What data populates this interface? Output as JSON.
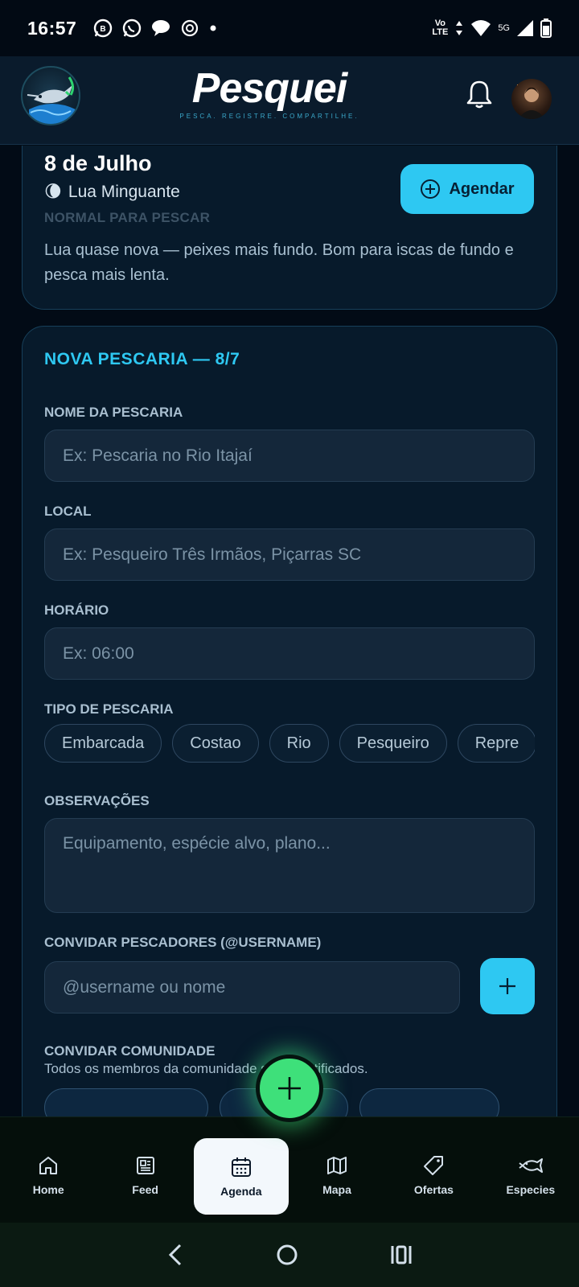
{
  "status_bar": {
    "time": "16:57",
    "network_top": "Vo",
    "network_bottom": "LTE",
    "signal_label": "5G"
  },
  "header": {
    "brand_name": "Pesquei",
    "brand_tagline": "PESCA. REGISTRE. COMPARTILHE."
  },
  "moon_card": {
    "date": "8 de Julho",
    "moon_icon": "🌘",
    "moon_phase": "Lua Minguante",
    "status": "NORMAL PARA PESCAR",
    "description": "Lua quase nova — peixes mais fundo. Bom para iscas de fundo e pesca mais lenta.",
    "schedule_button": "Agendar"
  },
  "form": {
    "title": "NOVA PESCARIA — 8/7",
    "name_label": "NOME DA PESCARIA",
    "name_placeholder": "Ex: Pescaria no Rio Itajaí",
    "location_label": "LOCAL",
    "location_placeholder": "Ex: Pesqueiro Três Irmãos, Piçarras SC",
    "time_label": "HORÁRIO",
    "time_placeholder": "Ex: 06:00",
    "type_label": "TIPO DE PESCARIA",
    "types": [
      "Embarcada",
      "Costao",
      "Rio",
      "Pesqueiro",
      "Repre"
    ],
    "notes_label": "OBSERVAÇÕES",
    "notes_placeholder": "Equipamento, espécie alvo, plano...",
    "invite_label": "CONVIDAR PESCADORES (@USERNAME)",
    "invite_placeholder": "@username ou nome",
    "community_label": "CONVIDAR COMUNIDADE",
    "community_desc": "Todos os membros da comunidade serão notificados."
  },
  "bottom_nav": {
    "items": [
      {
        "label": "Home",
        "icon": "home-icon"
      },
      {
        "label": "Feed",
        "icon": "newspaper-icon"
      },
      {
        "label": "Agenda",
        "icon": "calendar-icon"
      },
      {
        "label": "Mapa",
        "icon": "map-icon"
      },
      {
        "label": "Ofertas",
        "icon": "tag-icon"
      },
      {
        "label": "Especies",
        "icon": "fish-icon"
      }
    ],
    "active": "Agenda"
  },
  "colors": {
    "accent": "#2ec8f2",
    "fab": "#3ee07a",
    "card_bg": "#071a2b",
    "background": "#020b16"
  }
}
